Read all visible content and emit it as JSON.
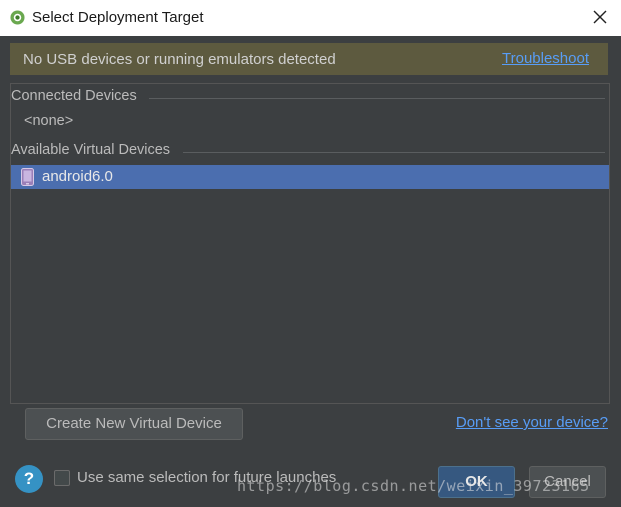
{
  "window": {
    "title": "Select Deployment Target",
    "app_icon": "android-studio-icon",
    "close_icon": "close-icon"
  },
  "banner": {
    "message": "No USB devices or running emulators detected",
    "link": "Troubleshoot"
  },
  "connected": {
    "header": "Connected Devices",
    "items": [
      "<none>"
    ]
  },
  "virtual": {
    "header": "Available Virtual Devices",
    "items": [
      {
        "label": "android6.0",
        "icon": "phone-icon",
        "selected": true
      }
    ]
  },
  "buttons": {
    "create": "Create New Virtual Device",
    "ok": "OK",
    "cancel": "Cancel"
  },
  "links": {
    "dont_see": "Don't see your device?"
  },
  "footer": {
    "help": "?",
    "checkbox_label": "Use same selection for future launches",
    "checkbox_checked": false
  },
  "watermark": "https://blog.csdn.net/weixin_39723165",
  "colors": {
    "dialog_bg": "#3c3f41",
    "banner_bg": "#5d5a3f",
    "selection": "#4b6eaf",
    "link": "#589df6",
    "help_bg": "#3592c4"
  }
}
